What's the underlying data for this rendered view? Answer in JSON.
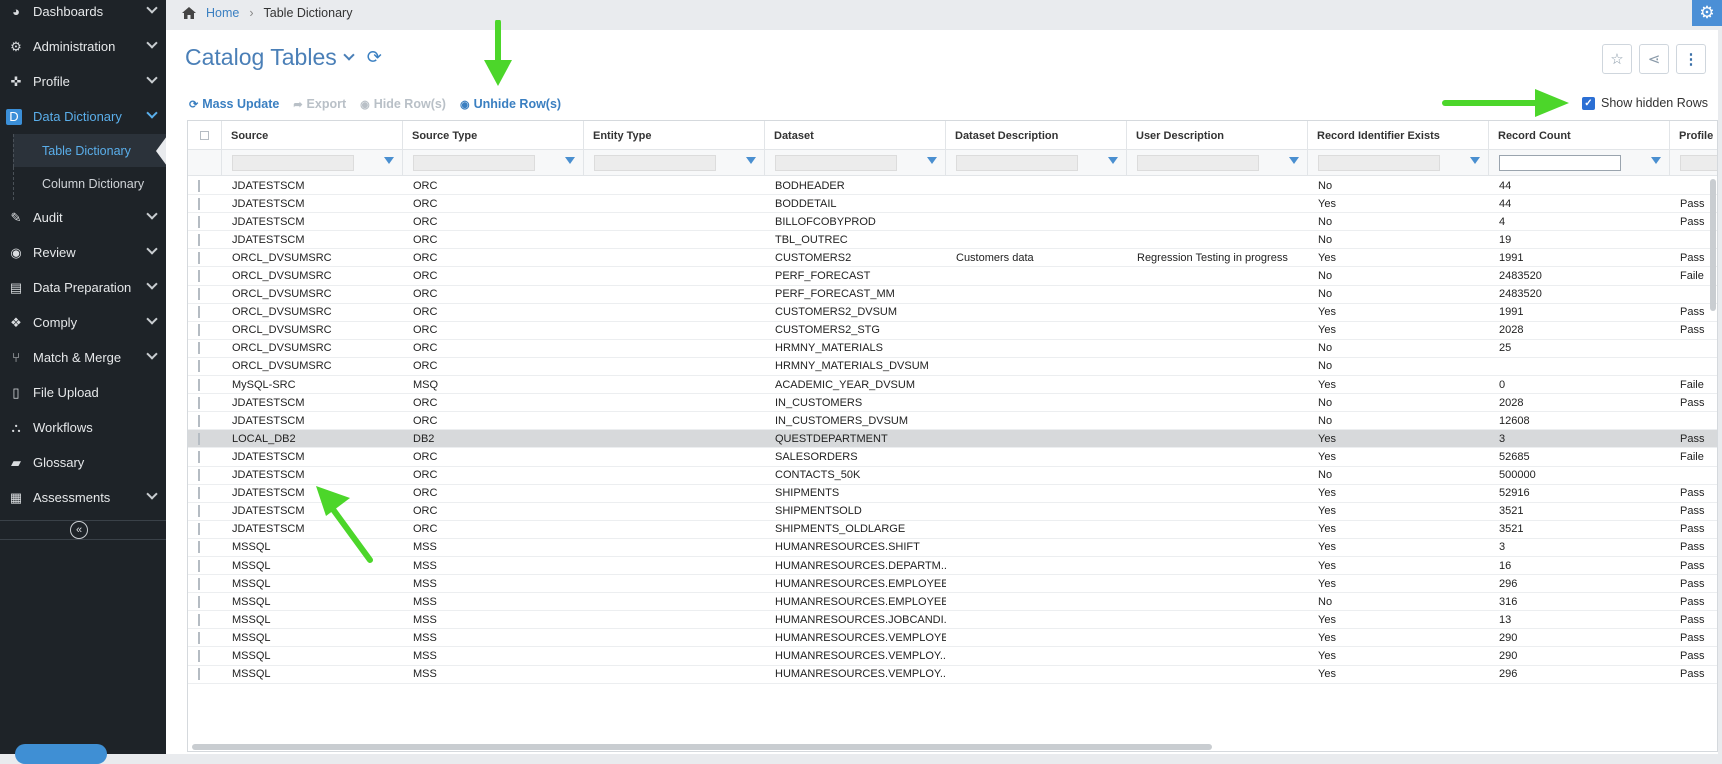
{
  "sidebar": {
    "items": [
      {
        "label": "Dashboards",
        "icon": "dashboard-icon",
        "glyph": "◕"
      },
      {
        "label": "Administration",
        "icon": "cogs-icon",
        "glyph": "⚙"
      },
      {
        "label": "Profile",
        "icon": "crosshair-icon",
        "glyph": "✜"
      },
      {
        "label": "Data Dictionary",
        "icon": "dictionary-icon",
        "glyph": "D"
      },
      {
        "label": "Table Dictionary"
      },
      {
        "label": "Column Dictionary"
      },
      {
        "label": "Audit",
        "icon": "edit-icon",
        "glyph": "✎"
      },
      {
        "label": "Review",
        "icon": "review-icon",
        "glyph": "◉"
      },
      {
        "label": "Data Preparation",
        "icon": "data-prep-icon",
        "glyph": "▤"
      },
      {
        "label": "Comply",
        "icon": "tags-icon",
        "glyph": "❖"
      },
      {
        "label": "Match & Merge",
        "icon": "merge-icon",
        "glyph": "⑂"
      },
      {
        "label": "File Upload",
        "icon": "file-icon",
        "glyph": "▯"
      },
      {
        "label": "Workflows",
        "icon": "workflow-icon",
        "glyph": "⛬"
      },
      {
        "label": "Glossary",
        "icon": "glossary-icon",
        "glyph": "▰"
      },
      {
        "label": "Assessments",
        "icon": "assessment-icon",
        "glyph": "▦"
      }
    ],
    "collapse_glyph": "«"
  },
  "breadcrumb": {
    "home": "Home",
    "separator": "›",
    "current": "Table Dictionary"
  },
  "page": {
    "title": "Catalog Tables",
    "refresh_glyph": "⟳",
    "star_glyph": "☆",
    "share_glyph": "⋖",
    "more_glyph": "⋮",
    "gear_glyph": "⚙"
  },
  "toolbar": {
    "mass_update": "Mass Update",
    "mass_update_glyph": "⟳",
    "export": "Export",
    "export_glyph": "➦",
    "hide_rows": "Hide Row(s)",
    "hide_glyph": "◉",
    "unhide_rows": "Unhide Row(s)",
    "unhide_glyph": "◉",
    "show_hidden": "Show hidden Rows",
    "show_hidden_checked": true,
    "check_glyph": "✓"
  },
  "table": {
    "columns": [
      "Source",
      "Source Type",
      "Entity Type",
      "Dataset",
      "Dataset Description",
      "User Description",
      "Record Identifier Exists",
      "Record Count",
      "Profile"
    ],
    "rows": [
      [
        "JDATESTSCM",
        "ORC",
        "",
        "BODHEADER",
        "",
        "",
        "No",
        "44",
        ""
      ],
      [
        "JDATESTSCM",
        "ORC",
        "",
        "BODDETAIL",
        "",
        "",
        "Yes",
        "44",
        "Pass"
      ],
      [
        "JDATESTSCM",
        "ORC",
        "",
        "BILLOFCOBYPROD",
        "",
        "",
        "No",
        "4",
        "Pass"
      ],
      [
        "JDATESTSCM",
        "ORC",
        "",
        "TBL_OUTREC",
        "",
        "",
        "No",
        "19",
        ""
      ],
      [
        "ORCL_DVSUMSRC",
        "ORC",
        "",
        "CUSTOMERS2",
        "Customers data",
        "Regression Testing in progress",
        "Yes",
        "1991",
        "Pass"
      ],
      [
        "ORCL_DVSUMSRC",
        "ORC",
        "",
        "PERF_FORECAST",
        "",
        "",
        "No",
        "2483520",
        "Faile"
      ],
      [
        "ORCL_DVSUMSRC",
        "ORC",
        "",
        "PERF_FORECAST_MM",
        "",
        "",
        "No",
        "2483520",
        ""
      ],
      [
        "ORCL_DVSUMSRC",
        "ORC",
        "",
        "CUSTOMERS2_DVSUM",
        "",
        "",
        "Yes",
        "1991",
        "Pass"
      ],
      [
        "ORCL_DVSUMSRC",
        "ORC",
        "",
        "CUSTOMERS2_STG",
        "",
        "",
        "Yes",
        "2028",
        "Pass"
      ],
      [
        "ORCL_DVSUMSRC",
        "ORC",
        "",
        "HRMNY_MATERIALS",
        "",
        "",
        "No",
        "25",
        ""
      ],
      [
        "ORCL_DVSUMSRC",
        "ORC",
        "",
        "HRMNY_MATERIALS_DVSUM",
        "",
        "",
        "No",
        "",
        ""
      ],
      [
        "MySQL-SRC",
        "MSQ",
        "",
        "ACADEMIC_YEAR_DVSUM",
        "",
        "",
        "Yes",
        "0",
        "Faile"
      ],
      [
        "JDATESTSCM",
        "ORC",
        "",
        "IN_CUSTOMERS",
        "",
        "",
        "No",
        "2028",
        "Pass"
      ],
      [
        "JDATESTSCM",
        "ORC",
        "",
        "IN_CUSTOMERS_DVSUM",
        "",
        "",
        "No",
        "12608",
        ""
      ],
      [
        "LOCAL_DB2",
        "DB2",
        "",
        "QUESTDEPARTMENT",
        "",
        "",
        "Yes",
        "3",
        "Pass"
      ],
      [
        "JDATESTSCM",
        "ORC",
        "",
        "SALESORDERS",
        "",
        "",
        "Yes",
        "52685",
        "Faile"
      ],
      [
        "JDATESTSCM",
        "ORC",
        "",
        "CONTACTS_50K",
        "",
        "",
        "No",
        "500000",
        ""
      ],
      [
        "JDATESTSCM",
        "ORC",
        "",
        "SHIPMENTS",
        "",
        "",
        "Yes",
        "52916",
        "Pass"
      ],
      [
        "JDATESTSCM",
        "ORC",
        "",
        "SHIPMENTSOLD",
        "",
        "",
        "Yes",
        "3521",
        "Pass"
      ],
      [
        "JDATESTSCM",
        "ORC",
        "",
        "SHIPMENTS_OLDLARGE",
        "",
        "",
        "Yes",
        "3521",
        "Pass"
      ],
      [
        "MSSQL",
        "MSS",
        "",
        "HUMANRESOURCES.SHIFT",
        "",
        "",
        "Yes",
        "3",
        "Pass"
      ],
      [
        "MSSQL",
        "MSS",
        "",
        "HUMANRESOURCES.DEPARTM...",
        "",
        "",
        "Yes",
        "16",
        "Pass"
      ],
      [
        "MSSQL",
        "MSS",
        "",
        "HUMANRESOURCES.EMPLOYEE...",
        "",
        "",
        "Yes",
        "296",
        "Pass"
      ],
      [
        "MSSQL",
        "MSS",
        "",
        "HUMANRESOURCES.EMPLOYEE...",
        "",
        "",
        "No",
        "316",
        "Pass"
      ],
      [
        "MSSQL",
        "MSS",
        "",
        "HUMANRESOURCES.JOBCANDI...",
        "",
        "",
        "Yes",
        "13",
        "Pass"
      ],
      [
        "MSSQL",
        "MSS",
        "",
        "HUMANRESOURCES.VEMPLOYEE",
        "",
        "",
        "Yes",
        "290",
        "Pass"
      ],
      [
        "MSSQL",
        "MSS",
        "",
        "HUMANRESOURCES.VEMPLOY...",
        "",
        "",
        "Yes",
        "290",
        "Pass"
      ],
      [
        "MSSQL",
        "MSS",
        "",
        "HUMANRESOURCES.VEMPLOY...",
        "",
        "",
        "Yes",
        "296",
        "Pass"
      ]
    ],
    "highlighted_row_index": 14
  },
  "colors": {
    "accent": "#3a7fc1",
    "sidebar_bg": "#1e2328",
    "annotation_arrow": "#4cd62a"
  }
}
